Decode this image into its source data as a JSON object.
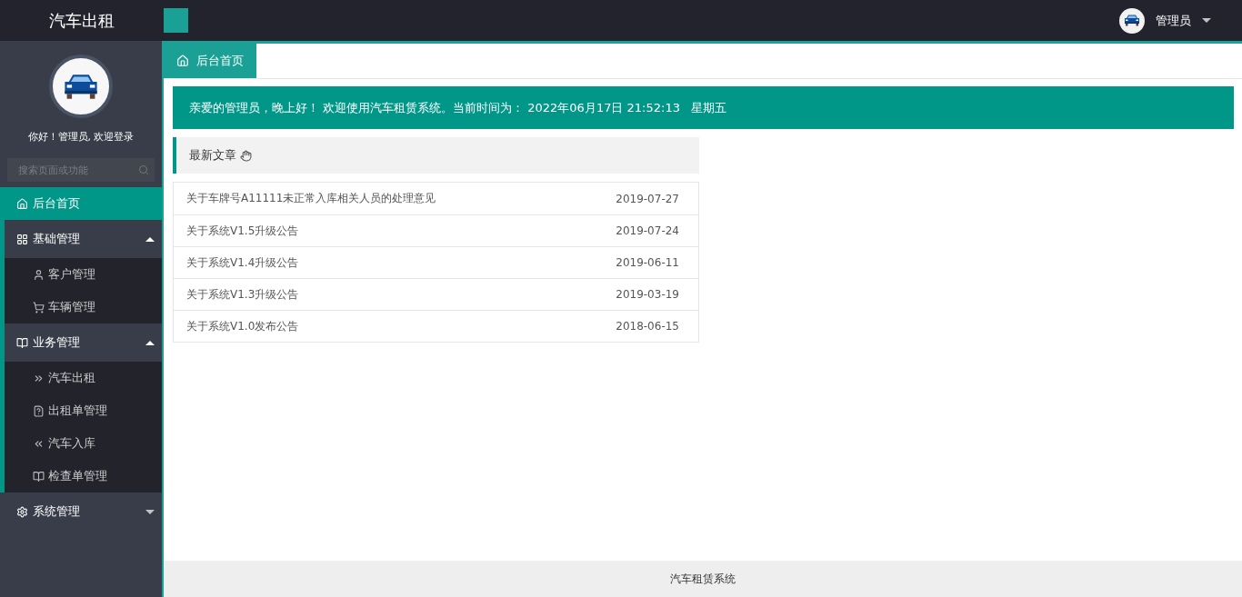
{
  "header": {
    "logo": "汽车出租",
    "user_name": "管理员"
  },
  "sidebar": {
    "greeting": "你好！管理员, 欢迎登录",
    "search": {
      "placeholder": "搜索页面或功能"
    },
    "menu": [
      {
        "label": "后台首页",
        "selected": true
      },
      {
        "label": "基础管理",
        "expanded": true,
        "children": [
          {
            "label": "客户管理",
            "selected": false
          },
          {
            "label": "车辆管理",
            "selected": false
          }
        ]
      },
      {
        "label": "业务管理",
        "expanded": true,
        "children": [
          {
            "label": "汽车出租",
            "selected": false
          },
          {
            "label": "出租单管理",
            "selected": false
          },
          {
            "label": "汽车入库",
            "selected": false
          },
          {
            "label": "检查单管理",
            "selected": false
          }
        ]
      },
      {
        "label": "系统管理",
        "expanded": false
      }
    ]
  },
  "tabs": [
    {
      "label": "后台首页",
      "selected": true
    }
  ],
  "welcome": "亲爱的管理员，晚上好！ 欢迎使用汽车租赁系统。当前时间为： 2022年06月17日 21:52:13   星期五",
  "articles": {
    "title": "最新文章",
    "rows": [
      {
        "title": "关于车牌号A11111未正常入库相关人员的处理意见",
        "date": "2019-07-27"
      },
      {
        "title": "关于系统V1.5升级公告",
        "date": "2019-07-24"
      },
      {
        "title": "关于系统V1.4升级公告",
        "date": "2019-06-11"
      },
      {
        "title": "关于系统V1.3升级公告",
        "date": "2019-03-19"
      },
      {
        "title": "关于系统V1.0发布公告",
        "date": "2018-06-15"
      }
    ]
  },
  "footer": "汽车租赁系统"
}
